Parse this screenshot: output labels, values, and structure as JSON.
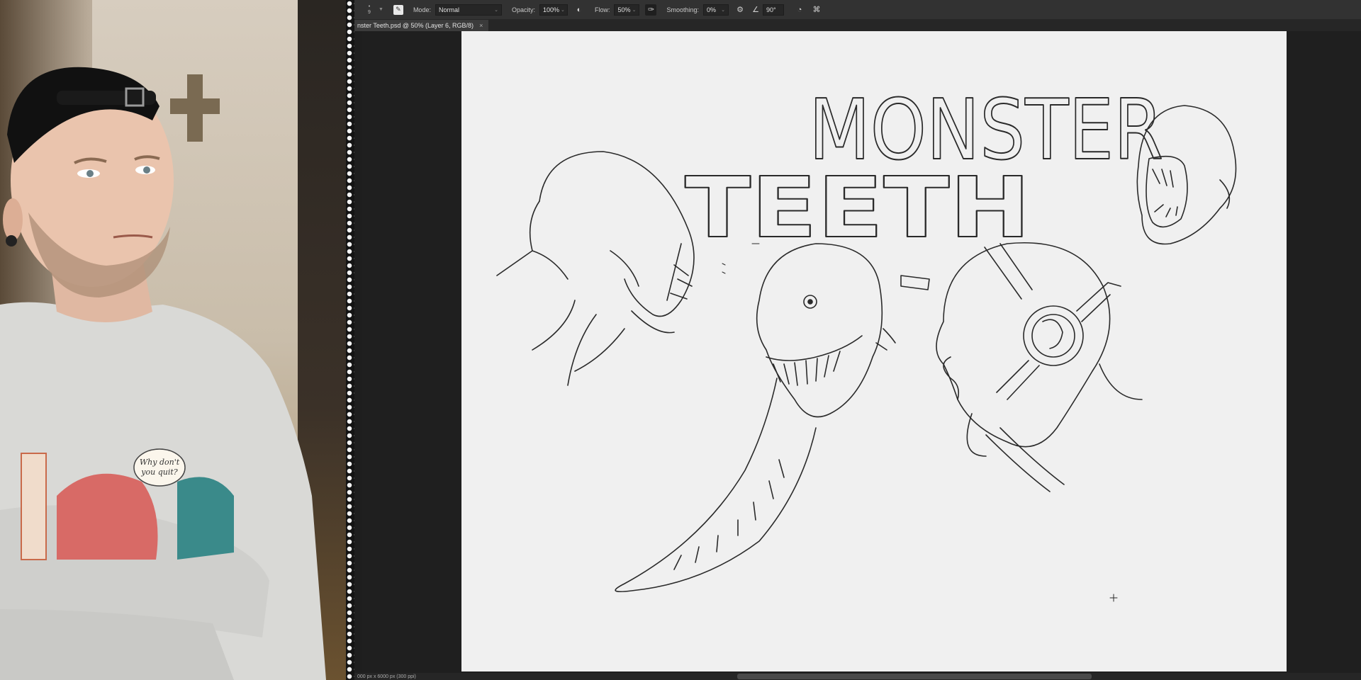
{
  "options_bar": {
    "brush_size": "9",
    "mode_label": "Mode:",
    "mode_value": "Normal",
    "opacity_label": "Opacity:",
    "opacity_value": "100%",
    "flow_label": "Flow:",
    "flow_value": "50%",
    "smoothing_label": "Smoothing:",
    "smoothing_value": "0%",
    "angle_value": "90°"
  },
  "document": {
    "tab_title": "nster Teeth.psd @ 50% (Layer 6, RGB/8)",
    "close_label": "×",
    "status": "000 px x 6000 px (300 ppi)"
  },
  "artwork": {
    "title_line1": "MONSTER",
    "title_line2": "TEETH"
  },
  "webcam": {
    "shirt_text_line1": "Why don't",
    "shirt_text_line2": "you quit?"
  },
  "icons": {
    "brush": "brush-icon",
    "airbrush": "airbrush-icon",
    "pressure": "pressure-icon",
    "gear": "gear-icon",
    "angle": "angle-icon",
    "symmetry": "symmetry-icon",
    "butterfly": "butterfly-icon"
  }
}
